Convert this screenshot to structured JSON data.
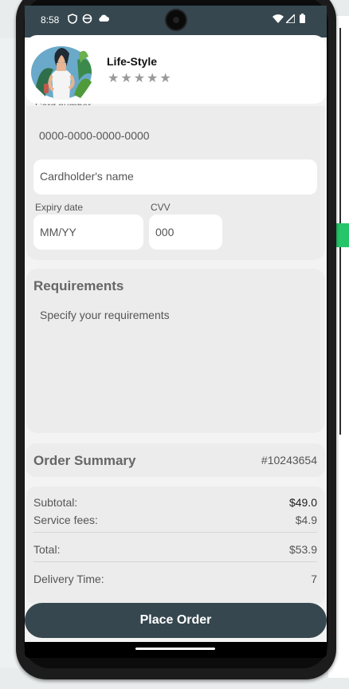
{
  "status_bar": {
    "time": "8:58"
  },
  "header": {
    "title": "Life-Style",
    "rating": "★★★★★"
  },
  "payment": {
    "card_number_label": "Card number",
    "card_number_placeholder": "0000-0000-0000-0000",
    "cardholder_placeholder": "Cardholder's name",
    "expiry_label": "Expiry date",
    "expiry_placeholder": "MM/YY",
    "cvv_label": "CVV",
    "cvv_placeholder": "000"
  },
  "requirements": {
    "title": "Requirements",
    "placeholder": "Specify your requirements"
  },
  "order_summary": {
    "title": "Order Summary",
    "order_id": "#10243654",
    "subtotal_label": "Subtotal:",
    "subtotal_value": "$49.0",
    "fees_label": "Service fees:",
    "fees_value": "$4.9",
    "total_label": "Total:",
    "total_value": "$53.9",
    "delivery_label": "Delivery Time:",
    "delivery_value": "7"
  },
  "actions": {
    "place_order": "Place Order"
  },
  "colors": {
    "primary": "#36474f",
    "screen_bg": "#f3f3f3",
    "card_bg": "#ececec"
  }
}
